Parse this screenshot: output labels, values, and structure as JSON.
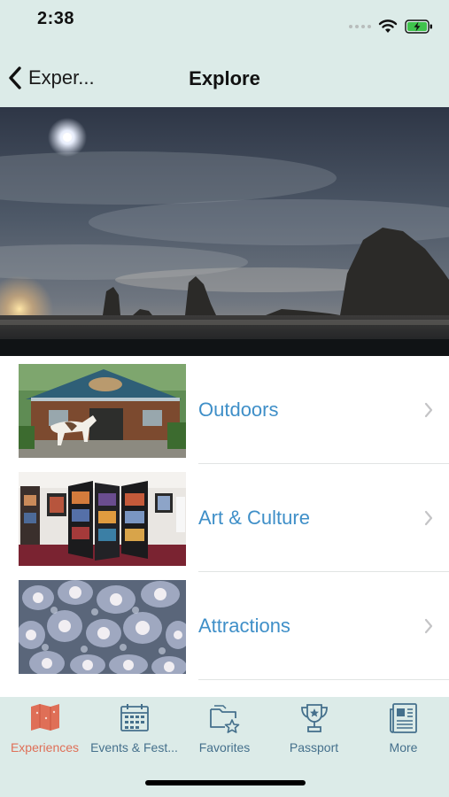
{
  "status_bar": {
    "time": "2:38"
  },
  "nav": {
    "back_label": "Exper...",
    "title": "Explore"
  },
  "categories": [
    {
      "label": "Outdoors"
    },
    {
      "label": "Art & Culture"
    },
    {
      "label": "Attractions"
    }
  ],
  "tabs": [
    {
      "label": "Experiences",
      "icon": "map-icon",
      "active": true
    },
    {
      "label": "Events & Fest...",
      "icon": "calendar-icon",
      "active": false
    },
    {
      "label": "Favorites",
      "icon": "favorites-folder-icon",
      "active": false
    },
    {
      "label": "Passport",
      "icon": "trophy-icon",
      "active": false
    },
    {
      "label": "More",
      "icon": "news-icon",
      "active": false
    }
  ],
  "colors": {
    "header_bg": "#dcebe8",
    "link_blue": "#3f8fc8",
    "tab_inactive": "#45708c",
    "tab_active": "#df6f57"
  }
}
